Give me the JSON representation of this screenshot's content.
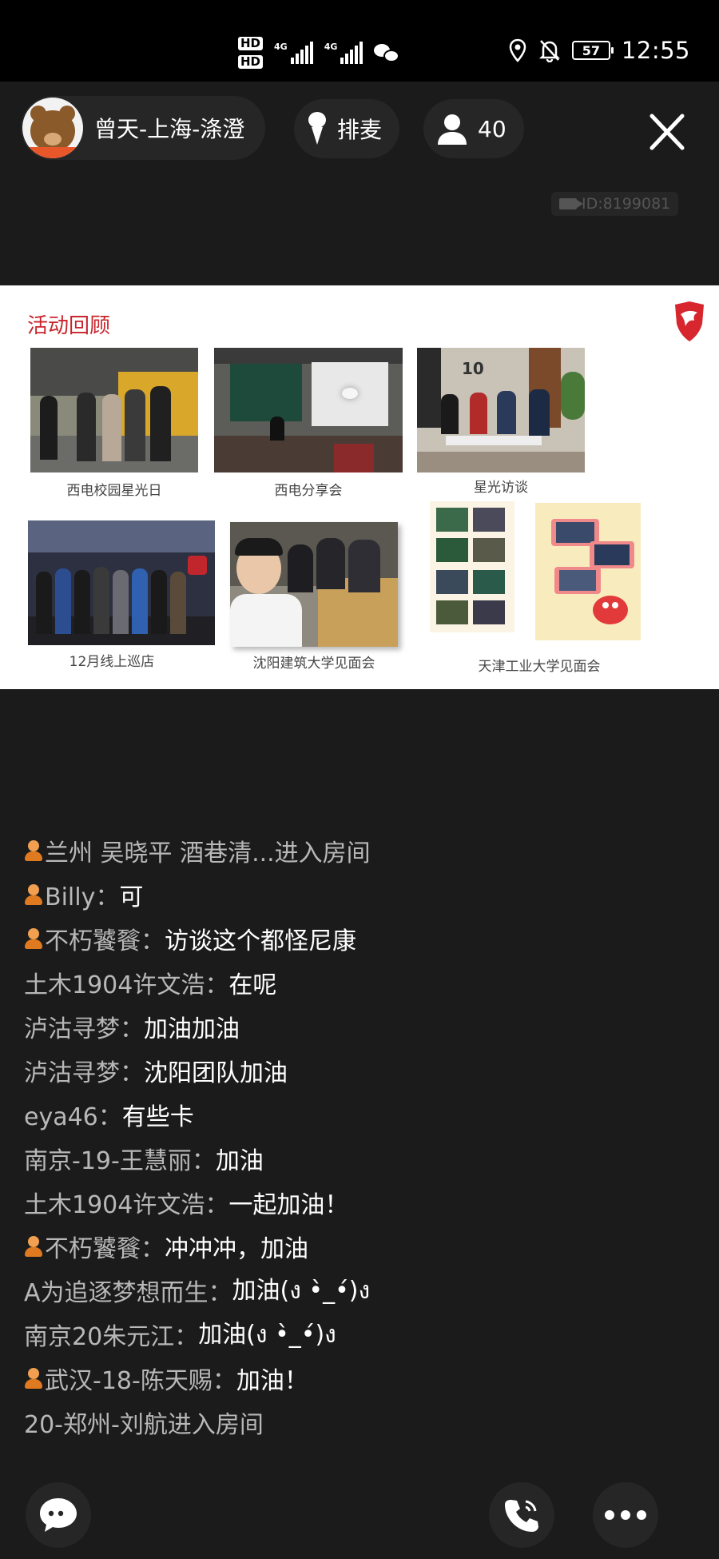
{
  "status_bar": {
    "hd1": "HD",
    "hd2": "HD",
    "net1": "4G",
    "net2": "4G",
    "battery": "57",
    "time": "12:55",
    "icons": [
      "wechat-icon",
      "location-icon",
      "bell-off-icon"
    ]
  },
  "room": {
    "host_name": "曾天-上海-涤澄",
    "mic_label": "排麦",
    "listener_count": "40",
    "room_id": "ID:8199081"
  },
  "slide": {
    "title": "活动回顾",
    "photos": [
      {
        "caption": "西电校园星光日"
      },
      {
        "caption": "西电分享会"
      },
      {
        "caption": "星光访谈"
      },
      {
        "caption": "12月线上巡店"
      },
      {
        "caption": "沈阳建筑大学见面会"
      },
      {
        "caption": "天津工业大学见面会"
      }
    ]
  },
  "chat": [
    {
      "badge": true,
      "user": "兰州 吴晓平 酒巷清...进入房间",
      "text": ""
    },
    {
      "badge": true,
      "user": "Billy：",
      "text": "可"
    },
    {
      "badge": true,
      "user": "不朽饕餮：",
      "text": "访谈这个都怪尼康"
    },
    {
      "badge": false,
      "user": "土木1904许文浩：",
      "text": "在呢"
    },
    {
      "badge": false,
      "user": "泸沽寻梦：",
      "text": "加油加油"
    },
    {
      "badge": false,
      "user": "泸沽寻梦：",
      "text": "沈阳团队加油"
    },
    {
      "badge": false,
      "user": "eya46：",
      "text": "有些卡"
    },
    {
      "badge": false,
      "user": "南京-19-王慧丽：",
      "text": "加油"
    },
    {
      "badge": false,
      "user": "土木1904许文浩：",
      "text": "一起加油！"
    },
    {
      "badge": true,
      "user": "不朽饕餮：",
      "text": "冲冲冲，加油"
    },
    {
      "badge": false,
      "user": "A为追逐梦想而生：",
      "text": "加油(ง •̀_•́)ง"
    },
    {
      "badge": false,
      "user": "南京20朱元江：",
      "text": "加油(ง •̀_•́)ง"
    },
    {
      "badge": true,
      "user": "武汉-18-陈天赐：",
      "text": "加油！"
    },
    {
      "badge": false,
      "user": "20-郑州-刘航进入房间",
      "text": ""
    }
  ],
  "bottom_bar": {
    "icons": [
      "chat-bubble-icon",
      "phone-call-icon",
      "more-icon"
    ]
  }
}
